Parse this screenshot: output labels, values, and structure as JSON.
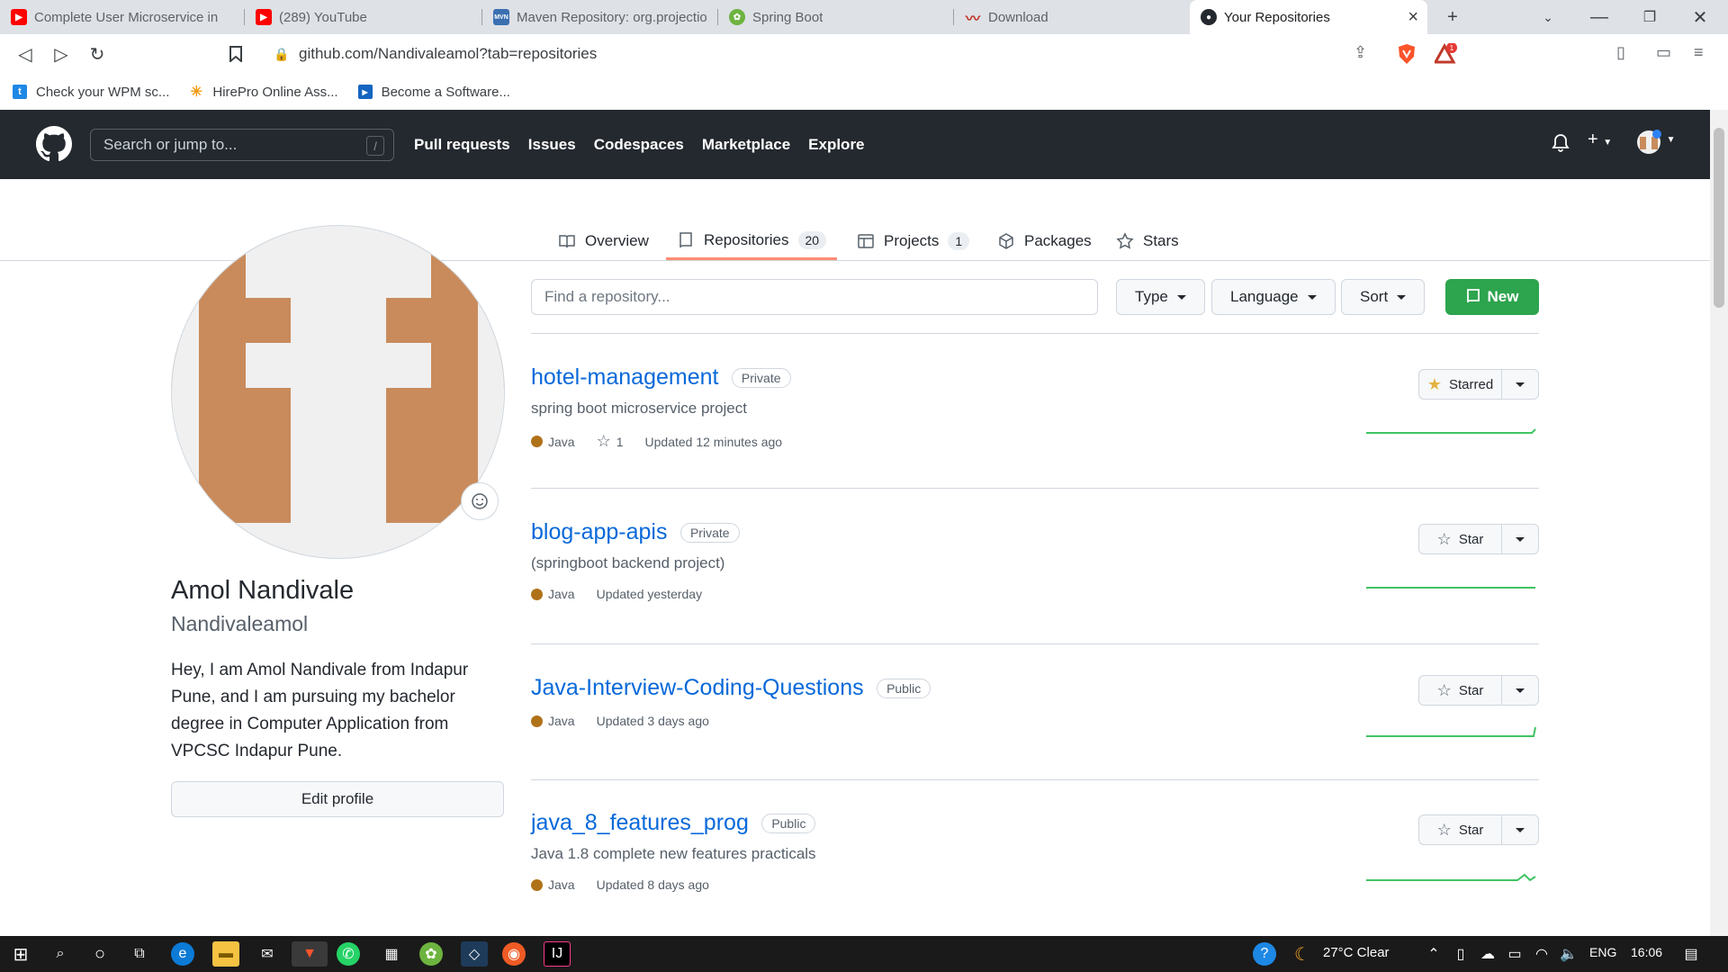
{
  "browser": {
    "tabs": [
      {
        "title": "Complete User Microservice in",
        "fav": "YT",
        "color": "#ff0000"
      },
      {
        "title": "(289) YouTube",
        "fav": "YT",
        "color": "#ff0000"
      },
      {
        "title": "Maven Repository: org.projection",
        "fav": "MVN",
        "color": "#3a6fb0"
      },
      {
        "title": "Spring Boot",
        "fav": "S",
        "color": "#6db33f"
      },
      {
        "title": "Download",
        "fav": "~",
        "color": "#c0392b"
      },
      {
        "title": "Your Repositories",
        "fav": "GH",
        "color": "#24292f"
      }
    ],
    "url": "github.com/Nandivaleamol?tab=repositories",
    "bookmarks": [
      {
        "label": "Check your WPM sc...",
        "icon": "t",
        "color": "#1e88e5"
      },
      {
        "label": "HirePro Online Ass...",
        "icon": "✳",
        "color": "#f39c12"
      },
      {
        "label": "Become a Software...",
        "icon": "▶",
        "color": "#1565c0"
      }
    ],
    "brave_badge": "1"
  },
  "gh_header": {
    "search_placeholder": "Search or jump to...",
    "search_key": "/",
    "nav": [
      "Pull requests",
      "Issues",
      "Codespaces",
      "Marketplace",
      "Explore"
    ]
  },
  "profile_tabs": {
    "overview": "Overview",
    "repositories": "Repositories",
    "repositories_count": "20",
    "projects": "Projects",
    "projects_count": "1",
    "packages": "Packages",
    "stars": "Stars"
  },
  "profile": {
    "name": "Amol Nandivale",
    "login": "Nandivaleamol",
    "bio": "Hey, I am Amol Nandivale from Indapur Pune, and I am pursuing my bachelor degree in Computer Application from VPCSC Indapur Pune.",
    "edit_label": "Edit profile",
    "avatar_color": "#c98b5c"
  },
  "repo_filters": {
    "find_placeholder": "Find a repository...",
    "type": "Type",
    "language": "Language",
    "sort": "Sort",
    "new": "New"
  },
  "repos": [
    {
      "name": "hotel-management",
      "visibility": "Private",
      "description": "spring boot microservice project",
      "language": "Java",
      "stars": "1",
      "updated": "Updated 12 minutes ago",
      "star_label": "Starred",
      "starred": true
    },
    {
      "name": "blog-app-apis",
      "visibility": "Private",
      "description": "(springboot backend project)",
      "language": "Java",
      "stars": "",
      "updated": "Updated yesterday",
      "star_label": "Star",
      "starred": false
    },
    {
      "name": "Java-Interview-Coding-Questions",
      "visibility": "Public",
      "description": "",
      "language": "Java",
      "stars": "",
      "updated": "Updated 3 days ago",
      "star_label": "Star",
      "starred": false
    },
    {
      "name": "java_8_features_prog",
      "visibility": "Public",
      "description": "Java 1.8 complete new features practicals",
      "language": "Java",
      "stars": "",
      "updated": "Updated 8 days ago",
      "star_label": "Star",
      "starred": false
    }
  ],
  "taskbar": {
    "weather": "27°C  Clear",
    "lang": "ENG",
    "time": "16:06"
  }
}
